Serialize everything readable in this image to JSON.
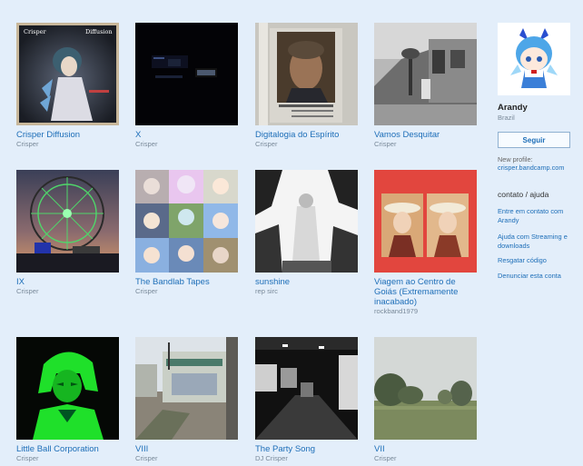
{
  "albums": [
    {
      "title": "Crisper Diffusion",
      "artist": "Crisper"
    },
    {
      "title": "X",
      "artist": "Crisper"
    },
    {
      "title": "Digitalogia do Espírito",
      "artist": "Crisper"
    },
    {
      "title": "Vamos Desquitar",
      "artist": "Crisper"
    },
    {
      "title": "IX",
      "artist": "Crisper"
    },
    {
      "title": "The Bandlab Tapes",
      "artist": "Crisper"
    },
    {
      "title": "sunshine",
      "artist": "rep sirc"
    },
    {
      "title": "Viagem ao Centro de Goiás (Extremamente inacabado)",
      "artist": "rockband1979"
    },
    {
      "title": "Little Ball Corporation",
      "artist": "Crisper"
    },
    {
      "title": "VIII",
      "artist": "Crisper"
    },
    {
      "title": "The Party Song",
      "artist": "DJ Crisper"
    },
    {
      "title": "VII",
      "artist": "Crisper"
    }
  ],
  "art_text": {
    "cover1_left": "Crisper",
    "cover1_right": "Diffusion"
  },
  "profile": {
    "name": "Arandy",
    "location": "Brazil",
    "follow_label": "Seguir",
    "new_profile_label": "New profile:",
    "new_profile_link": "crisper.bandcamp.com"
  },
  "help": {
    "heading": "contato / ajuda",
    "links": [
      "Entre em contato com Arandy",
      "Ajuda com Streaming e downloads",
      "Resgatar código",
      "Denunciar esta conta"
    ]
  },
  "colors": {
    "background": "#e3eefa",
    "link": "#1d6eb8",
    "muted": "#7a8a9a"
  }
}
